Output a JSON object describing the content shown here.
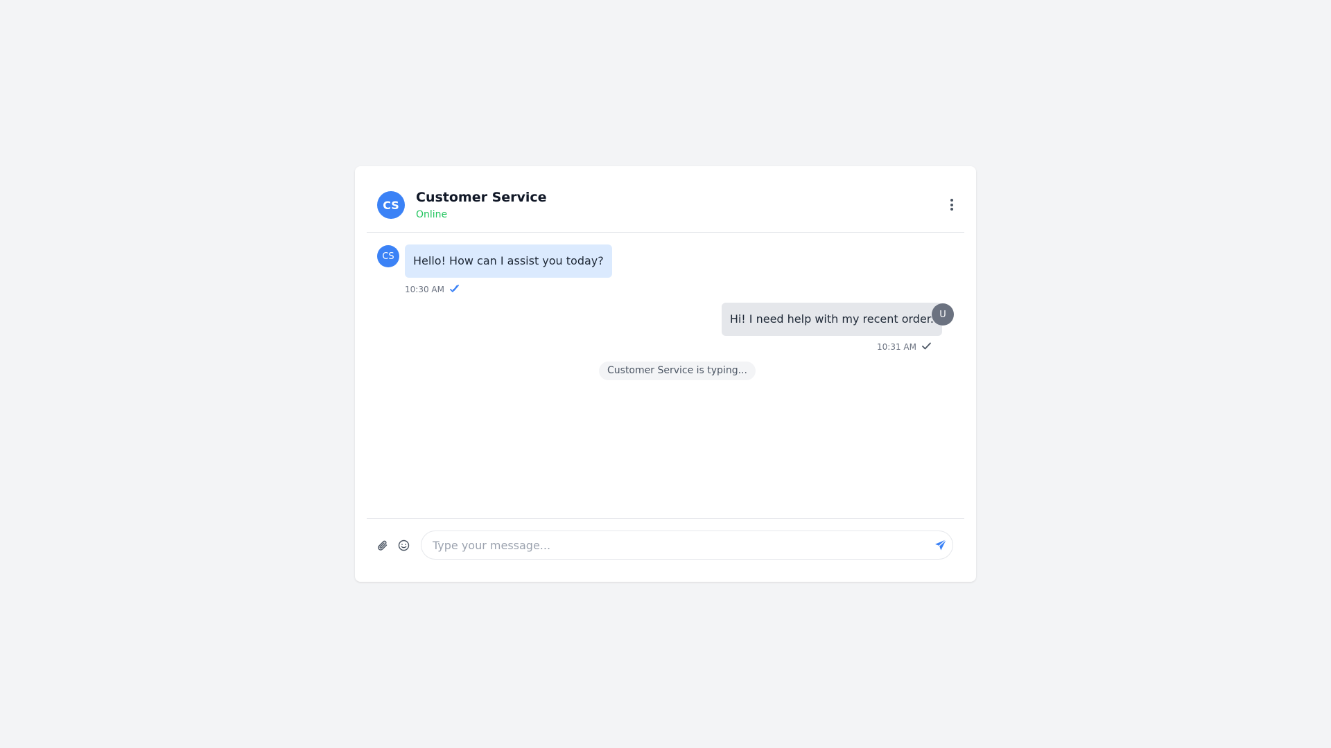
{
  "header": {
    "avatar_initials": "CS",
    "title": "Customer Service",
    "status": "Online"
  },
  "messages": [
    {
      "sender": "agent",
      "avatar_initials": "CS",
      "text": "Hello! How can I assist you today?",
      "time": "10:30 AM",
      "receipt": "double-check-icon"
    },
    {
      "sender": "user",
      "avatar_initials": "U",
      "text": "Hi! I need help with my recent order.",
      "time": "10:31 AM",
      "receipt": "check-icon"
    }
  ],
  "typing_indicator": "Customer Service is typing...",
  "composer": {
    "placeholder": "Type your message...",
    "value": ""
  },
  "colors": {
    "accent": "#3b82f6",
    "online": "#22c55e",
    "agent_bubble": "#dbeafe",
    "user_bubble": "#e5e7eb",
    "user_avatar": "#6b7280"
  },
  "icons": [
    "more-vertical-icon",
    "paperclip-icon",
    "smile-icon",
    "send-icon",
    "double-check-icon",
    "check-icon"
  ]
}
